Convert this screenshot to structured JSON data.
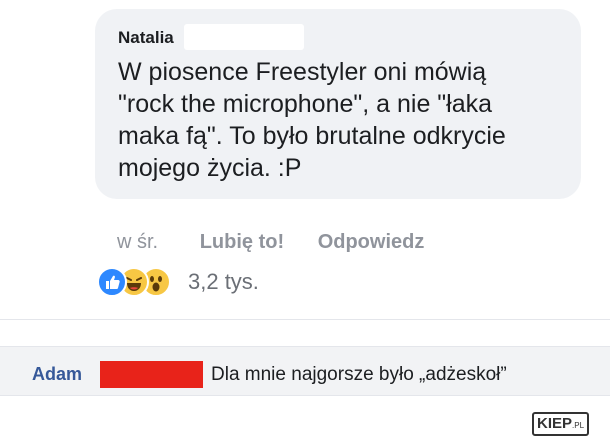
{
  "comment_top": {
    "author": "Natalia",
    "lines": [
      "W piosence Freestyler oni mówią",
      "\"rock the microphone\", a nie \"łaka",
      "maka fą\". To było brutalne odkrycie",
      "mojego życia. :P"
    ],
    "time": "w śr.",
    "like_label": "Lubię to!",
    "reply_label": "Odpowiedz",
    "reactions": [
      "like-reaction-icon",
      "haha-reaction-icon",
      "wow-reaction-icon"
    ],
    "reaction_count": "3,2 tys."
  },
  "comment_reply": {
    "author": "Adam",
    "text": "Dla mnie najgorsze było „adżeskoł”"
  },
  "watermark": {
    "brand": "KIEP",
    "suffix": ".PL"
  },
  "colors": {
    "bubble_bg": "#f0f2f5",
    "secondary_text": "#90949c",
    "link_blue": "#365899",
    "redaction_red": "#e8231a",
    "like_blue": "#2d88ff"
  }
}
